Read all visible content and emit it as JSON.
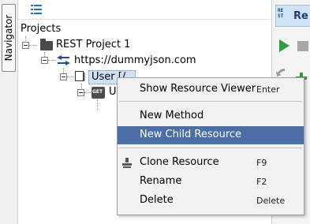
{
  "navigator": {
    "tab_label": "Navigator",
    "toolbar_icon": "list-icon"
  },
  "tree": {
    "root": "Projects",
    "project": "REST Project 1",
    "service": "https://dummyjson.com",
    "resource_partial": "User [/",
    "method_prefix": "U",
    "method_badge": "GET"
  },
  "editor": {
    "tab_text": "Re",
    "tab_icon_line1": "RE",
    "tab_icon_line2": "ST"
  },
  "context_menu": {
    "items": [
      {
        "label": "Show Resource Viewer",
        "shortcut": "Enter"
      },
      {
        "label": "New Method",
        "shortcut": ""
      },
      {
        "label": "New Child Resource",
        "shortcut": ""
      },
      {
        "label": "Clone Resource",
        "shortcut": "F9"
      },
      {
        "label": "Rename",
        "shortcut": "F2"
      },
      {
        "label": "Delete",
        "shortcut": "Delete"
      }
    ],
    "selected": "New Child Resource"
  },
  "colors": {
    "selection": "#4a6fa8",
    "play": "#2e9f3d",
    "tab_bg": "#cfe3f5"
  }
}
